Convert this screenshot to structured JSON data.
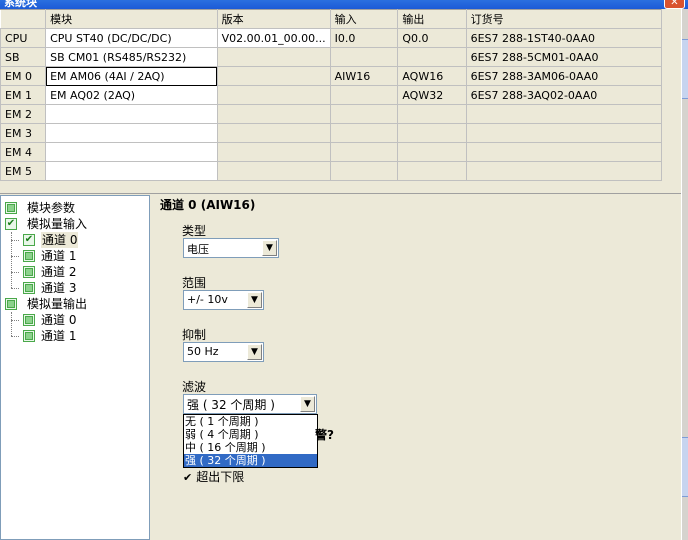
{
  "window": {
    "title": "系统块",
    "close_glyph": "✕"
  },
  "config_table": {
    "columns": [
      "",
      "模块",
      "版本",
      "输入",
      "输出",
      "订货号"
    ],
    "rows": [
      {
        "slot": "CPU",
        "module": "CPU ST40 (DC/DC/DC)",
        "version": "V02.00.01_00.00...",
        "input": "I0.0",
        "output": "Q0.0",
        "order": "6ES7 288-1ST40-0AA0"
      },
      {
        "slot": "SB",
        "module": "SB CM01 (RS485/RS232)",
        "version": "",
        "input": "",
        "output": "",
        "order": "6ES7 288-5CM01-0AA0"
      },
      {
        "slot": "EM 0",
        "module": "EM AM06 (4AI / 2AQ)",
        "version": "",
        "input": "AIW16",
        "output": "AQW16",
        "order": "6ES7 288-3AM06-0AA0"
      },
      {
        "slot": "EM 1",
        "module": "EM AQ02 (2AQ)",
        "version": "",
        "input": "",
        "output": "AQW32",
        "order": "6ES7 288-3AQ02-0AA0"
      },
      {
        "slot": "EM 2",
        "module": "",
        "version": "",
        "input": "",
        "output": "",
        "order": ""
      },
      {
        "slot": "EM 3",
        "module": "",
        "version": "",
        "input": "",
        "output": "",
        "order": ""
      },
      {
        "slot": "EM 4",
        "module": "",
        "version": "",
        "input": "",
        "output": "",
        "order": ""
      },
      {
        "slot": "EM 5",
        "module": "",
        "version": "",
        "input": "",
        "output": "",
        "order": ""
      }
    ]
  },
  "tree": {
    "items": [
      {
        "label": "模块参数",
        "checked": false
      },
      {
        "label": "模拟量输入",
        "checked": true
      },
      {
        "label": "通道 0",
        "checked": true
      },
      {
        "label": "通道 1",
        "checked": false
      },
      {
        "label": "通道 2",
        "checked": false
      },
      {
        "label": "通道 3",
        "checked": false
      },
      {
        "label": "模拟量输出",
        "checked": false
      },
      {
        "label": "通道 0",
        "checked": false
      },
      {
        "label": "通道 1",
        "checked": false
      }
    ],
    "check_glyph": "✔"
  },
  "panel": {
    "heading": "通道 0 (AIW16)",
    "type_label": "类型",
    "type_value": "电压",
    "range_label": "范围",
    "range_value": "+/- 10v",
    "suppress_label": "抑制",
    "suppress_value": "50 Hz",
    "filter_label": "滤波",
    "filter_value": "强 ( 32 个周期 )",
    "filter_options": [
      "无 ( 1 个周期 )",
      "弱 ( 4 个周期 )",
      "中 ( 16 个周期 )",
      "强 ( 32 个周期 )"
    ],
    "alarm_partial": "警?",
    "underflow_label": "超出下限",
    "underflow_checked": true,
    "dropdown_arrow": "▼"
  }
}
